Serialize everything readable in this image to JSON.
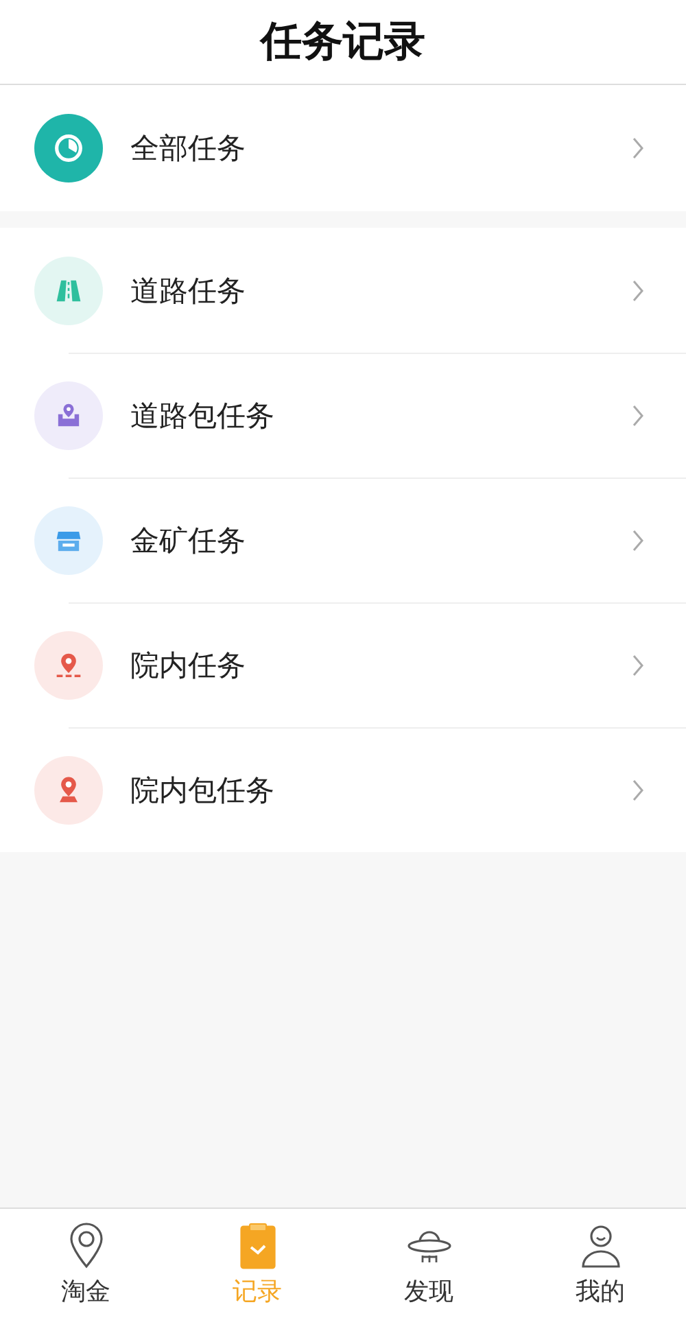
{
  "header": {
    "title": "任务记录"
  },
  "groups": [
    {
      "items": [
        {
          "label": "全部任务",
          "kind": "pie",
          "color": "#1fb5a9",
          "solid": true
        }
      ]
    },
    {
      "items": [
        {
          "label": "道路任务",
          "kind": "road",
          "color": "#2fbf9d",
          "solid": false
        },
        {
          "label": "道路包任务",
          "kind": "pin-box",
          "color": "#8a6fd6",
          "solid": false
        },
        {
          "label": "金矿任务",
          "kind": "shop",
          "color": "#3b9be8",
          "solid": false
        },
        {
          "label": "院内任务",
          "kind": "pin-line",
          "color": "#e5594a",
          "solid": false
        },
        {
          "label": "院内包任务",
          "kind": "pin-base",
          "color": "#e5594a",
          "solid": false
        }
      ]
    }
  ],
  "tabs": [
    {
      "label": "淘金",
      "kind": "location",
      "selected": false
    },
    {
      "label": "记录",
      "kind": "clipboard",
      "selected": true
    },
    {
      "label": "发现",
      "kind": "ufo",
      "selected": false
    },
    {
      "label": "我的",
      "kind": "person",
      "selected": false
    }
  ]
}
